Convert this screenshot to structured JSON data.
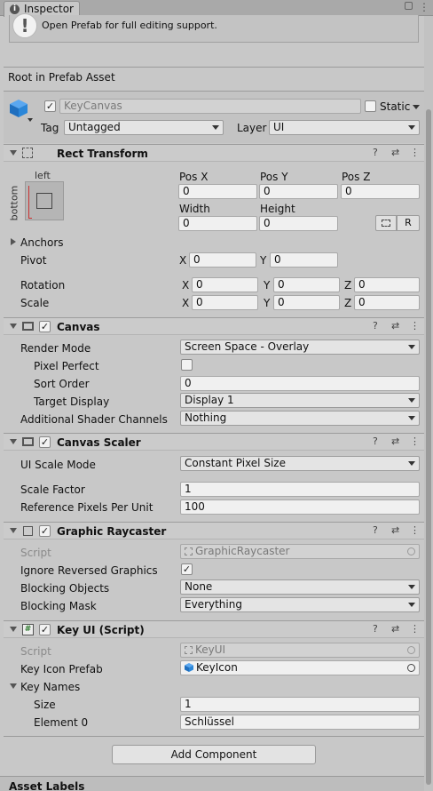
{
  "tab": {
    "title": "Inspector",
    "icon": "info-icon"
  },
  "notice": {
    "text": "Open Prefab for full editing support.",
    "icon": "warning-icon"
  },
  "prefab_root": "Root in Prefab Asset",
  "gameobject": {
    "name": "KeyCanvas",
    "static_label": "Static",
    "tag_label": "Tag",
    "tag_value": "Untagged",
    "layer_label": "Layer",
    "layer_value": "UI"
  },
  "rect_transform": {
    "title": "Rect Transform",
    "anchor_left": "left",
    "anchor_bottom": "bottom",
    "posx_label": "Pos X",
    "posx": "0",
    "posy_label": "Pos Y",
    "posy": "0",
    "posz_label": "Pos Z",
    "posz": "0",
    "width_label": "Width",
    "width": "0",
    "height_label": "Height",
    "height": "0",
    "raw_button": "R",
    "anchors_label": "Anchors",
    "pivot_label": "Pivot",
    "pivot_x_label": "X",
    "pivot_x": "0",
    "pivot_y_label": "Y",
    "pivot_y": "0",
    "rotation_label": "Rotation",
    "rot_x_label": "X",
    "rot_x": "0",
    "rot_y_label": "Y",
    "rot_y": "0",
    "rot_z_label": "Z",
    "rot_z": "0",
    "scale_label": "Scale",
    "scale_x_label": "X",
    "scale_x": "0",
    "scale_y_label": "Y",
    "scale_y": "0",
    "scale_z_label": "Z",
    "scale_z": "0"
  },
  "canvas": {
    "title": "Canvas",
    "render_mode_label": "Render Mode",
    "render_mode": "Screen Space - Overlay",
    "pixel_perfect_label": "Pixel Perfect",
    "sort_order_label": "Sort Order",
    "sort_order": "0",
    "target_display_label": "Target Display",
    "target_display": "Display 1",
    "shader_channels_label": "Additional Shader Channels",
    "shader_channels": "Nothing"
  },
  "canvas_scaler": {
    "title": "Canvas Scaler",
    "ui_scale_mode_label": "UI Scale Mode",
    "ui_scale_mode": "Constant Pixel Size",
    "scale_factor_label": "Scale Factor",
    "scale_factor": "1",
    "ref_pixels_label": "Reference Pixels Per Unit",
    "ref_pixels": "100"
  },
  "graphic_raycaster": {
    "title": "Graphic Raycaster",
    "script_label": "Script",
    "script": "GraphicRaycaster",
    "ignore_reversed_label": "Ignore Reversed Graphics",
    "ignore_reversed_check": "✓",
    "blocking_objects_label": "Blocking Objects",
    "blocking_objects": "None",
    "blocking_mask_label": "Blocking Mask",
    "blocking_mask": "Everything"
  },
  "key_ui": {
    "title": "Key UI (Script)",
    "script_label": "Script",
    "script": "KeyUI",
    "key_icon_prefab_label": "Key Icon Prefab",
    "key_icon_prefab": "KeyIcon",
    "key_names_label": "Key Names",
    "size_label": "Size",
    "size": "1",
    "element0_label": "Element 0",
    "element0": "Schlüssel"
  },
  "add_component": "Add Component",
  "asset_labels": "Asset Labels",
  "header_icons": {
    "help": "?",
    "presets": "⇄",
    "menu": "⋮"
  },
  "checkmark": "✓",
  "colors": {
    "panel": "#c8c8c8",
    "header": "#cbcbcb",
    "field": "#f0f0f0",
    "accent_blue": "#2a78c8"
  }
}
